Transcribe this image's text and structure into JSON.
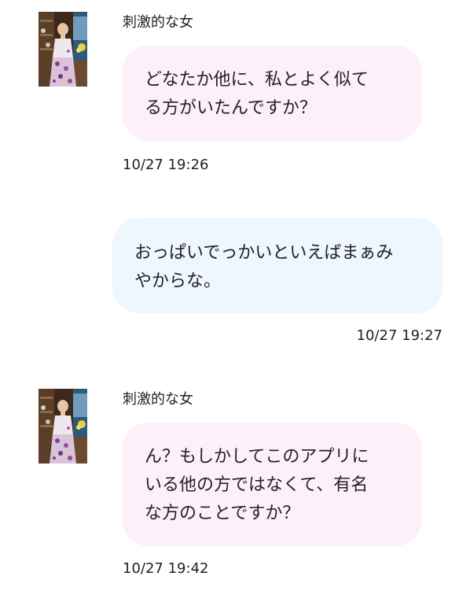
{
  "messages": [
    {
      "direction": "incoming",
      "sender": "刺激的な女",
      "lines": [
        "どなたか他に、私とよく似て",
        "る方がいたんですか？"
      ],
      "time": "10/27 19:26"
    },
    {
      "direction": "outgoing",
      "lines": [
        "おっぱいでっかいといえばまぁみ",
        "やからな。"
      ],
      "time": "10/27 19:27"
    },
    {
      "direction": "incoming",
      "sender": "刺激的な女",
      "lines": [
        "ん？もしかしてこのアプリに",
        "いる他の方ではなくて、有名",
        "な方のことですか？"
      ],
      "time": "10/27 19:42"
    }
  ],
  "colors": {
    "incoming_bubble": "#fdf0fb",
    "outgoing_bubble": "#eef6fe",
    "text": "#222222"
  },
  "icons": {
    "avatar": "profile-photo-woman-in-floral-dress"
  }
}
